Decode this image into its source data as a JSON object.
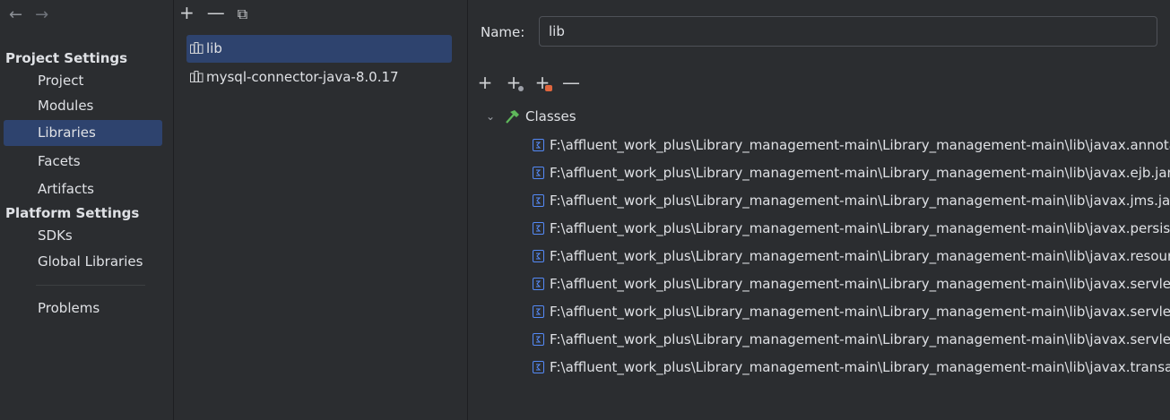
{
  "left": {
    "project_settings_title": "Project Settings",
    "project_items": [
      "Project",
      "Modules",
      "Libraries",
      "Facets",
      "Artifacts"
    ],
    "platform_settings_title": "Platform Settings",
    "platform_items": [
      "SDKs",
      "Global Libraries"
    ],
    "problems": "Problems",
    "selected": "Libraries"
  },
  "middle": {
    "libraries": [
      "lib",
      "mysql-connector-java-8.0.17"
    ],
    "selected": "lib"
  },
  "right": {
    "name_label": "Name:",
    "name_value": "lib",
    "tree_root": "Classes",
    "classes": [
      "F:\\affluent_work_plus\\Library_management-main\\Library_management-main\\lib\\javax.annota",
      "F:\\affluent_work_plus\\Library_management-main\\Library_management-main\\lib\\javax.ejb.jar",
      "F:\\affluent_work_plus\\Library_management-main\\Library_management-main\\lib\\javax.jms.jar",
      "F:\\affluent_work_plus\\Library_management-main\\Library_management-main\\lib\\javax.persist",
      "F:\\affluent_work_plus\\Library_management-main\\Library_management-main\\lib\\javax.resourc",
      "F:\\affluent_work_plus\\Library_management-main\\Library_management-main\\lib\\javax.servlet",
      "F:\\affluent_work_plus\\Library_management-main\\Library_management-main\\lib\\javax.servlet",
      "F:\\affluent_work_plus\\Library_management-main\\Library_management-main\\lib\\javax.servlet",
      "F:\\affluent_work_plus\\Library_management-main\\Library_management-main\\lib\\javax.transac"
    ]
  },
  "colors": {
    "background": "#2b2d30",
    "selection": "#2e436e",
    "text": "#dfe1e5",
    "hammer_green": "#5fb85b",
    "jar_blue": "#548af7"
  }
}
